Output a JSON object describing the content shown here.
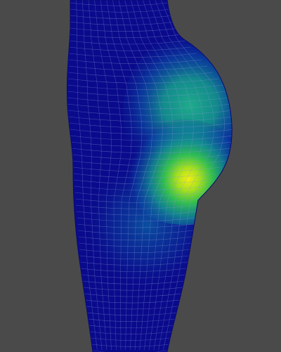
{
  "viewport": {
    "background_color": "#4a4a4a"
  },
  "mesh_model": {
    "subject": "body-contour-mesh",
    "base_color": "#0a0a8c",
    "wireframe_color": "#8a9ad8",
    "heatmap_colors": {
      "low": "#0a0a8c",
      "mid_low": "#0a5aa8",
      "mid": "#14a08c",
      "mid_high": "#34c84a",
      "high": "#f0f014"
    }
  }
}
